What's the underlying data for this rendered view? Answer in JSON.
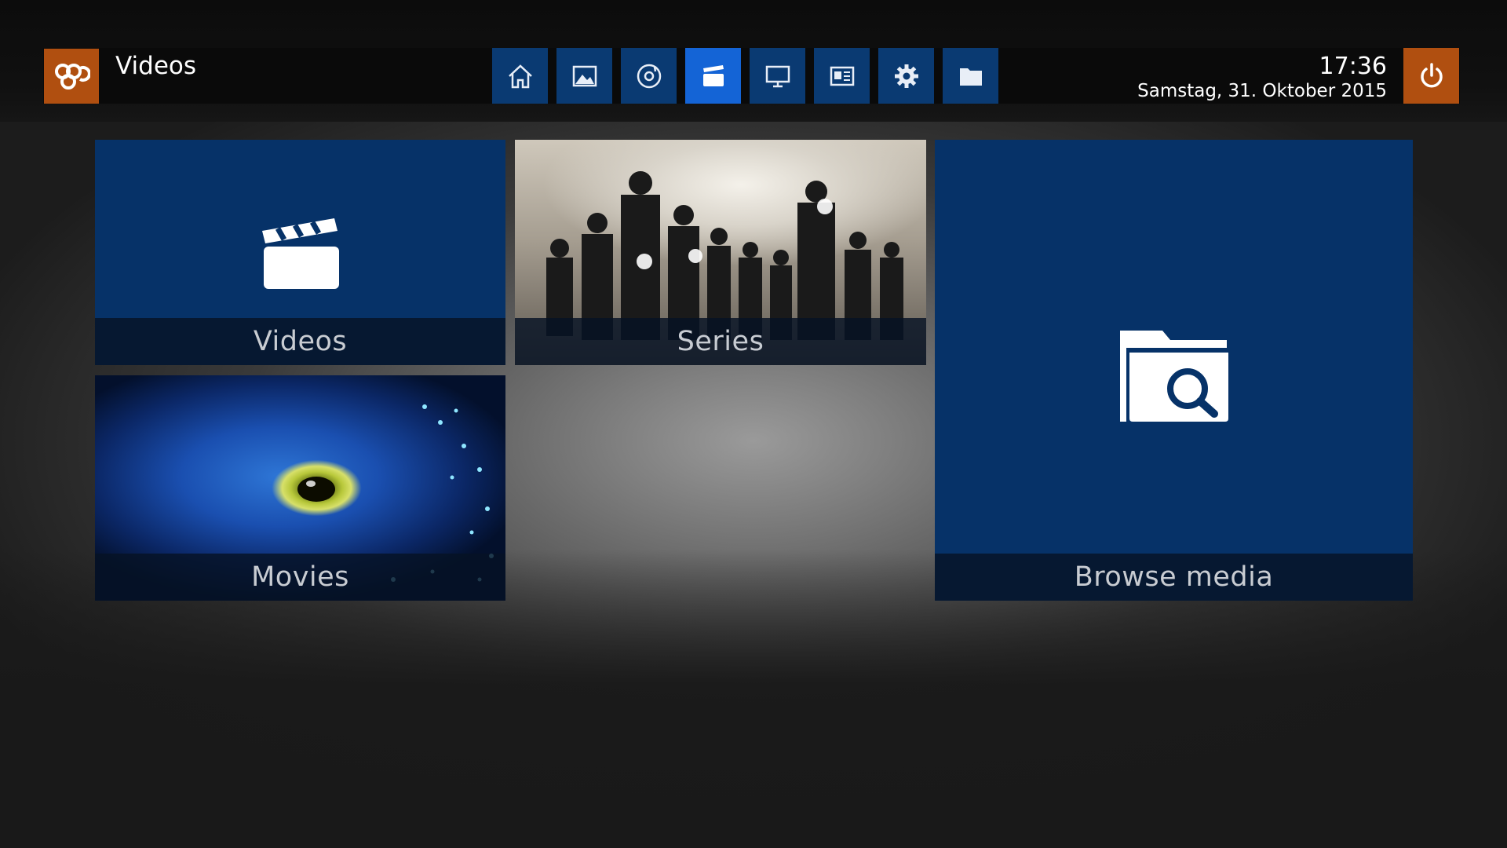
{
  "header": {
    "logo_icon": "mediaportal-logo-icon",
    "title": "Videos",
    "time": "17:36",
    "date": "Samstag, 31. Oktober 2015",
    "power_icon": "power-icon"
  },
  "nav": {
    "items": [
      {
        "icon": "home-icon",
        "active": false
      },
      {
        "icon": "pictures-icon",
        "active": false
      },
      {
        "icon": "music-disc-icon",
        "active": false
      },
      {
        "icon": "clapperboard-icon",
        "active": true
      },
      {
        "icon": "tv-icon",
        "active": false
      },
      {
        "icon": "news-icon",
        "active": false
      },
      {
        "icon": "settings-gear-icon",
        "active": false
      },
      {
        "icon": "folder-icon",
        "active": false
      }
    ]
  },
  "tiles": {
    "videos": {
      "label": "Videos",
      "icon": "clapperboard-icon"
    },
    "series": {
      "label": "Series"
    },
    "movies": {
      "label": "Movies"
    },
    "browse": {
      "label": "Browse media",
      "icon": "folder-search-icon"
    }
  },
  "colors": {
    "accent_orange": "#b04f10",
    "nav_blue": "#0a3a72",
    "nav_active_blue": "#1464d6",
    "tile_blue": "#063268"
  }
}
